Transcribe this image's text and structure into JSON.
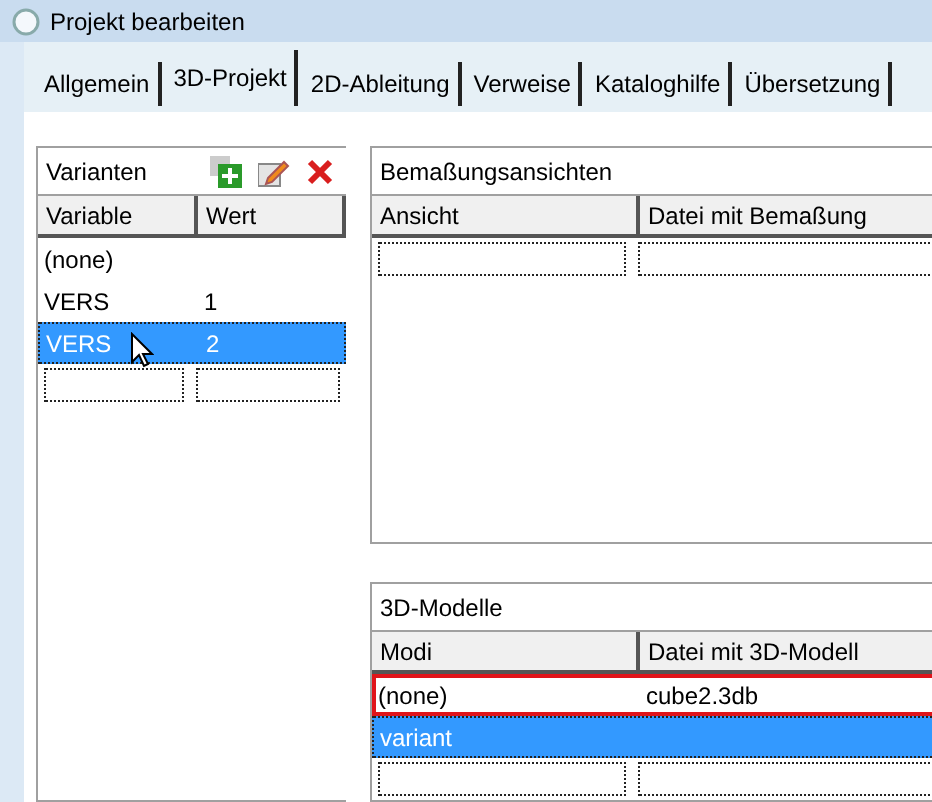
{
  "window": {
    "title": "Projekt bearbeiten"
  },
  "tabs": [
    {
      "label": "Allgemein",
      "selected": false
    },
    {
      "label": "3D-Projekt",
      "selected": true
    },
    {
      "label": "2D-Ableitung",
      "selected": false
    },
    {
      "label": "Verweise",
      "selected": false
    },
    {
      "label": "Kataloghilfe",
      "selected": false
    },
    {
      "label": "Übersetzung",
      "selected": false
    }
  ],
  "variants": {
    "title": "Varianten",
    "columns": [
      "Variable",
      "Wert"
    ],
    "rows": [
      {
        "kind": "data",
        "cells": [
          "(none)",
          ""
        ],
        "selected": false
      },
      {
        "kind": "data",
        "cells": [
          "VERS",
          "1"
        ],
        "selected": false
      },
      {
        "kind": "data",
        "cells": [
          "VERS",
          "2"
        ],
        "selected": true
      },
      {
        "kind": "placeholder",
        "selected": false
      }
    ]
  },
  "dimension_views": {
    "title": "Bemaßungsansichten",
    "columns": [
      "Ansicht",
      "Datei mit Bemaßung"
    ],
    "rows": [
      {
        "kind": "placeholder",
        "selected": false
      }
    ]
  },
  "models": {
    "title": "3D-Modelle",
    "columns": [
      "Modi",
      "Datei mit 3D-Modell"
    ],
    "rows": [
      {
        "kind": "data",
        "cells": [
          "(none)",
          "cube2.3db"
        ],
        "selected": false,
        "highlighted": true
      },
      {
        "kind": "data",
        "cells": [
          "variant",
          ""
        ],
        "selected": true,
        "highlighted": false
      },
      {
        "kind": "placeholder",
        "selected": false,
        "highlighted": false
      }
    ]
  }
}
